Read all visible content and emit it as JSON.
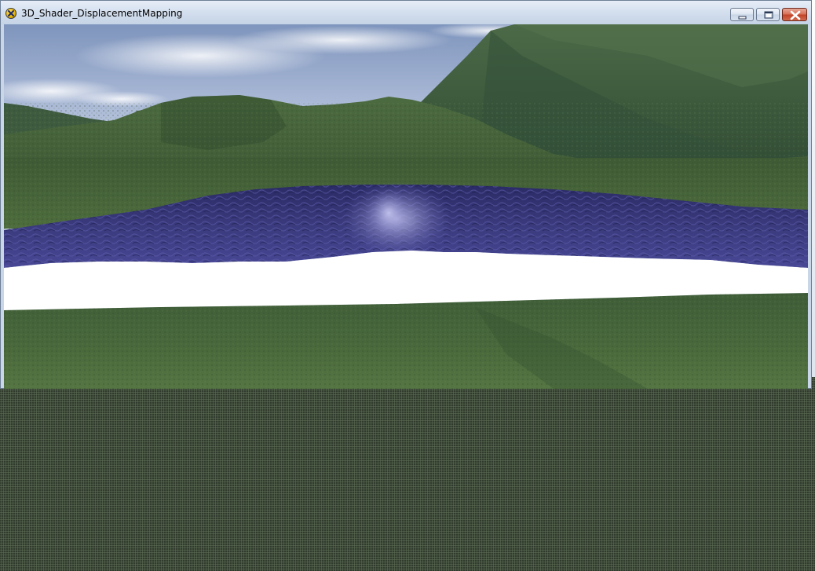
{
  "window": {
    "title": "3D_Shader_DisplacementMapping",
    "app_icon": "directx-x-icon",
    "controls": {
      "minimize_icon": "minimize-icon",
      "maximize_icon": "maximize-icon",
      "close_icon": "close-icon"
    }
  },
  "scene": {
    "sky_color": "#9db0cf",
    "mountain_color": "#3f5a3a",
    "water_color": "#3b3b7a",
    "grass_color": "#4b6a3c",
    "gap_color": "#ffffff"
  },
  "colors": {
    "title_bar_top": "#e7eef8",
    "close_button": "#c2452a",
    "undrawn_area": "#3f4c3a"
  }
}
